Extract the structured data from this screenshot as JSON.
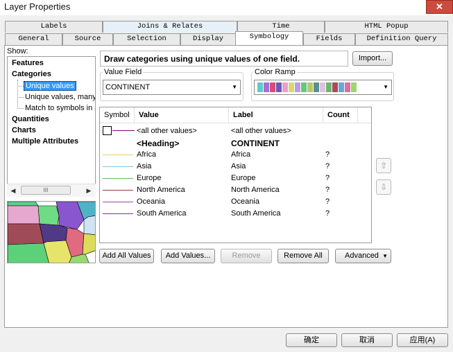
{
  "window": {
    "title": "Layer Properties",
    "close_label": "✕"
  },
  "tabs_row1": [
    {
      "label": "Labels"
    },
    {
      "label": "Joins & Relates"
    },
    {
      "label": "Time"
    },
    {
      "label": "HTML Popup"
    }
  ],
  "tabs_row2": [
    {
      "label": "General"
    },
    {
      "label": "Source"
    },
    {
      "label": "Selection"
    },
    {
      "label": "Display"
    },
    {
      "label": "Symbology"
    },
    {
      "label": "Fields"
    },
    {
      "label": "Definition Query"
    }
  ],
  "active_tab": "Symbology",
  "show_label": "Show:",
  "tree": {
    "features": "Features",
    "categories": "Categories",
    "unique_values": "Unique values",
    "unique_values_many": "Unique values, many",
    "match_symbols": "Match to symbols in a",
    "quantities": "Quantities",
    "charts": "Charts",
    "multiple_attributes": "Multiple Attributes",
    "scroll_thumb": "III"
  },
  "description": "Draw categories using unique values of one field.",
  "import_button": "Import...",
  "value_field": {
    "label": "Value Field",
    "value": "CONTINENT"
  },
  "color_ramp": {
    "label": "Color Ramp",
    "colors": [
      "#63c8c8",
      "#a070d8",
      "#d84c78",
      "#6a5ab8",
      "#e8a0c8",
      "#d8d870",
      "#b8a0e0",
      "#66c87a",
      "#b8c870",
      "#5a9090",
      "#e0c0e0",
      "#6ab870",
      "#a84c58",
      "#68a8d8",
      "#d870a0",
      "#98d870"
    ]
  },
  "table": {
    "headers": {
      "symbol": "Symbol",
      "value": "Value",
      "label": "Label",
      "count": "Count"
    },
    "rows": [
      {
        "value": "<all other values>",
        "label": "<all other values>",
        "count": "",
        "color": "#800080",
        "type": "other"
      },
      {
        "value": "<Heading>",
        "label": "CONTINENT",
        "count": "",
        "color": "",
        "type": "heading"
      },
      {
        "value": "Africa",
        "label": "Africa",
        "count": "?",
        "color": "#e6d25a",
        "type": "item"
      },
      {
        "value": "Asia",
        "label": "Asia",
        "count": "?",
        "color": "#7fc6e0",
        "type": "item"
      },
      {
        "value": "Europe",
        "label": "Europe",
        "count": "?",
        "color": "#5cc05a",
        "type": "item"
      },
      {
        "value": "North America",
        "label": "North America",
        "count": "?",
        "color": "#a03838",
        "type": "item"
      },
      {
        "value": "Oceania",
        "label": "Oceania",
        "count": "?",
        "color": "#a040b0",
        "type": "item"
      },
      {
        "value": "South America",
        "label": "South America",
        "count": "?",
        "color": "#8030a0",
        "type": "item"
      }
    ]
  },
  "move_up": "⇧",
  "move_down": "⇩",
  "buttons": {
    "add_all": "Add All Values",
    "add_values": "Add Values...",
    "remove": "Remove",
    "remove_all": "Remove All",
    "advanced": "Advanced"
  },
  "footer": {
    "ok": "确定",
    "cancel": "取消",
    "apply": "应用(A)"
  }
}
